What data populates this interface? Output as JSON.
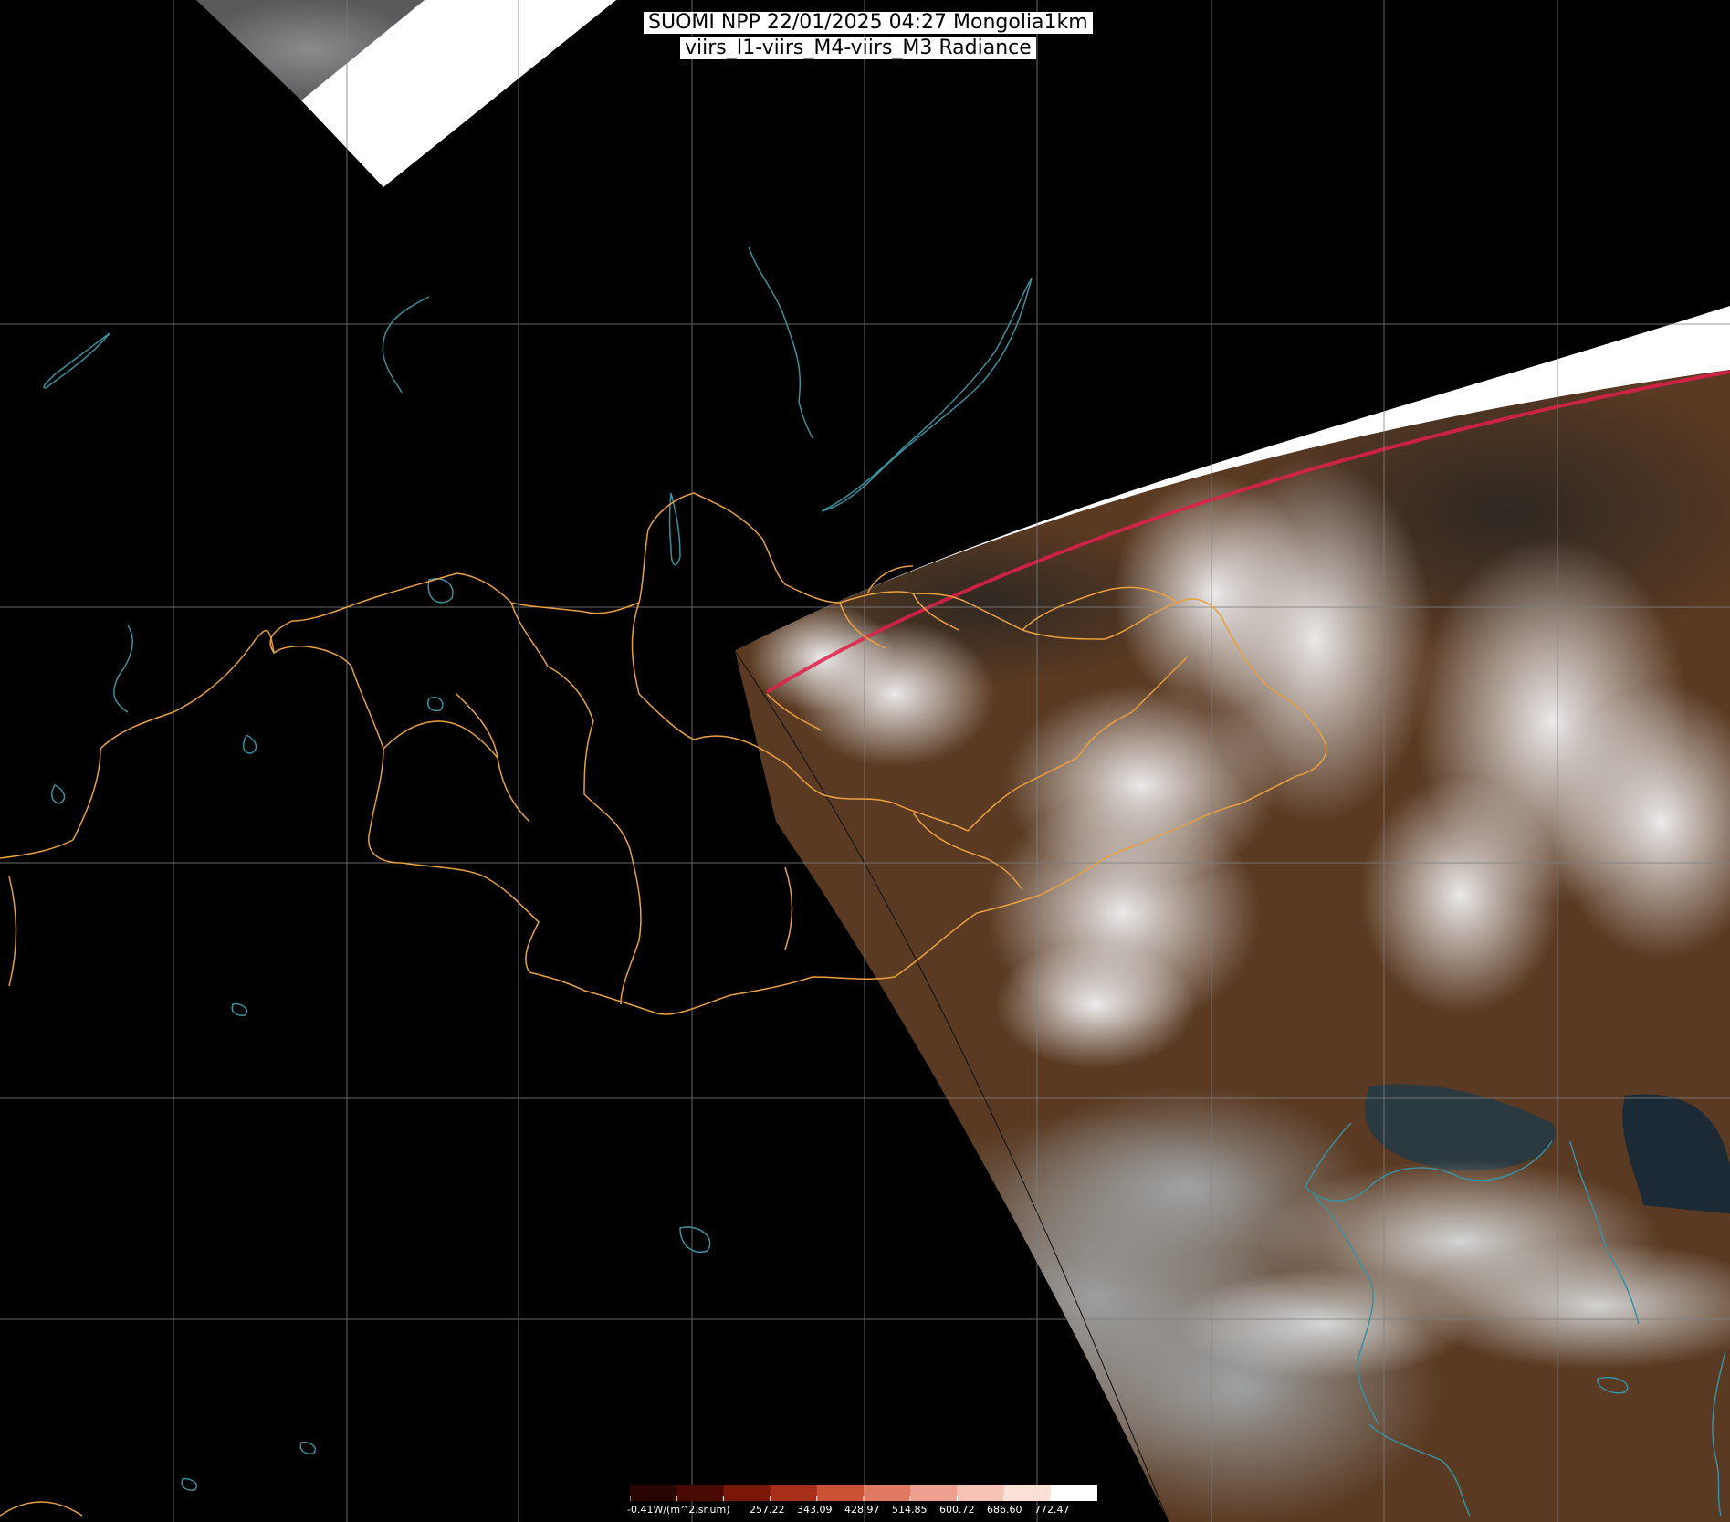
{
  "title": {
    "line1": "SUOMI NPP 22/01/2025 04:27 Mongolia1km",
    "line2": "viirs_I1-viirs_M4-viirs_M3 Radiance"
  },
  "colorbar": {
    "unit_label": "-0.41W/(m^2.sr.um)",
    "ticks": [
      "257.22",
      "343.09",
      "428.97",
      "514.85",
      "600.72",
      "686.60",
      "772.47"
    ],
    "colors": [
      "#2a0400",
      "#4a0a04",
      "#7a1808",
      "#a8301a",
      "#cc5236",
      "#e07a62",
      "#eea090",
      "#f6c2b6",
      "#fbe0d8",
      "#ffffff"
    ]
  },
  "colors": {
    "background": "#000000",
    "graticule": "#808080",
    "borders": "#e8a040",
    "coastline": "#3a8fa0",
    "swath_fill": "#ffffff",
    "scan_edge": "#e0204a",
    "land_brown": "#5a3a22",
    "snow": "#e8e8ea",
    "sea": "#2a3a44",
    "haze": "#9aa4a8"
  }
}
